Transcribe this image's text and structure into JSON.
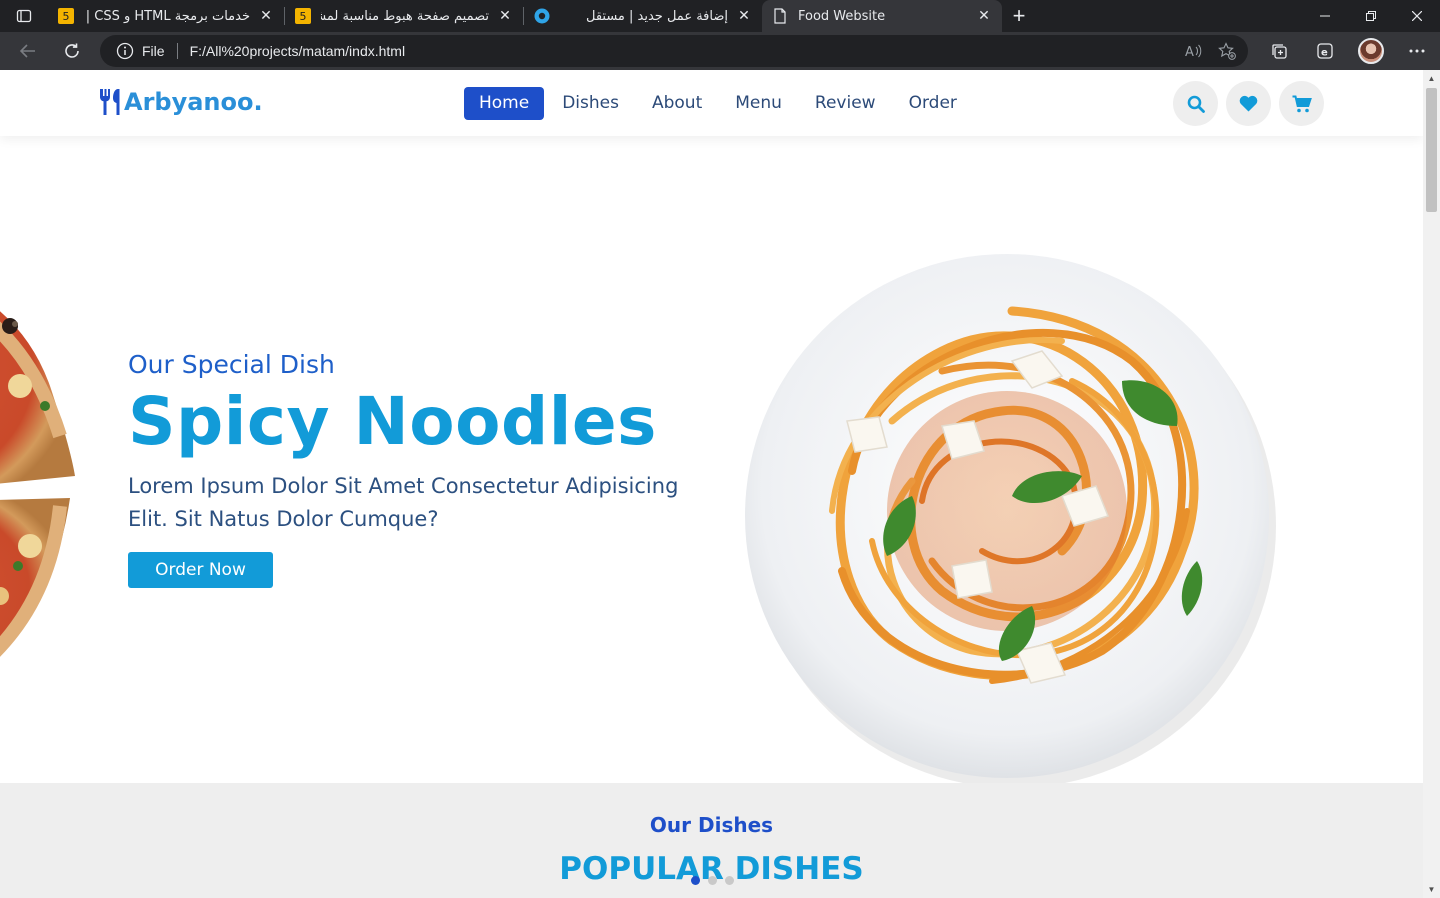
{
  "browser": {
    "tabs": [
      {
        "title": "خدمات برمجة HTML و CSS | برمجة",
        "favicon": "hsoub-5-icon",
        "active": false
      },
      {
        "title": "تصميم صفحة هبوط مناسبة لمشروع",
        "favicon": "hsoub-5-icon",
        "active": false
      },
      {
        "title": "إضافة عمل جديد | مستقل",
        "favicon": "mostaql-icon",
        "active": false
      },
      {
        "title": "Food Website",
        "favicon": "page-icon",
        "active": true
      }
    ],
    "address": {
      "scheme": "File",
      "url": "F:/All%20projects/matam/indx.html"
    },
    "tab_close": "✕",
    "new_tab": "+"
  },
  "site": {
    "logo_text": "Arbyanoo.",
    "nav": [
      {
        "label": "Home",
        "active": true
      },
      {
        "label": "Dishes",
        "active": false
      },
      {
        "label": "About",
        "active": false
      },
      {
        "label": "Menu",
        "active": false
      },
      {
        "label": "Review",
        "active": false
      },
      {
        "label": "Order",
        "active": false
      }
    ],
    "header_icons": [
      "search-icon",
      "heart-icon",
      "cart-icon"
    ],
    "colors": {
      "primary": "#129bd8",
      "accent": "#1e4fc9",
      "text": "#2c5080",
      "section_bg": "#eeeeee"
    }
  },
  "hero": {
    "subtitle": "Our Special Dish",
    "title": "Spicy Noodles",
    "description": "Lorem Ipsum Dolor Sit Amet Consectetur Adipisicing Elit. Sit Natus Dolor Cumque?",
    "button": "Order Now"
  },
  "dishes_section": {
    "subtitle": "Our Dishes",
    "title": "POPULAR DISHES"
  },
  "slider": {
    "count": 3,
    "active_index": 0
  }
}
